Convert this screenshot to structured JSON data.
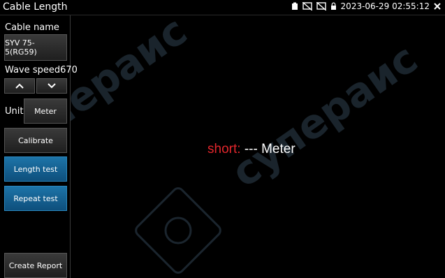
{
  "window": {
    "title": "Cable Length"
  },
  "status": {
    "datetime": "2023-06-29 02:55:12"
  },
  "sidebar": {
    "cable_name_label": "Cable name",
    "cable_name_value": "SYV 75-5(RG59)",
    "wave_speed_label": "Wave speed",
    "wave_speed_value": "670",
    "up_symbol": "^",
    "down_symbol": "⌄",
    "unit_label": "Unit",
    "unit_value": "Meter",
    "calibrate": "Calibrate",
    "length_test": "Length test",
    "repeat_test": "Repeat test",
    "create_report": "Create Report"
  },
  "result": {
    "prefix": "short:",
    "value": "---",
    "unit": "Meter"
  },
  "watermark": {
    "text": "супераис"
  },
  "colors": {
    "accent_blue": "#1d74a8",
    "short_red": "#e3262c"
  }
}
